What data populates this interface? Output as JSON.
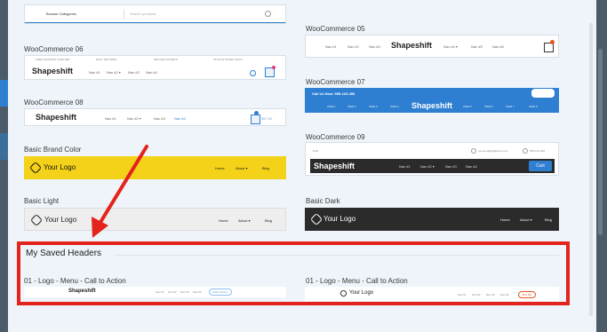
{
  "search_header": {
    "category_label": "Browse Categories",
    "placeholder": "Search products..."
  },
  "woo05": {
    "title": "WooCommerce 05",
    "logo": "Shapeshift",
    "nav": [
      "Nav #1",
      "Nav #2",
      "Nav #3",
      "Nav #4 ▾",
      "Nav #5",
      "Nav #6"
    ]
  },
  "woo06": {
    "title": "WooCommerce 06",
    "topbar": [
      "FREE SHIPPING OVER $60",
      "EASY RETURNS",
      "SECURE PAYMENT",
      "30 DAYS MONEY BACK"
    ],
    "logo": "Shapeshift",
    "nav": [
      "Nav #1",
      "Nav #2 ▾",
      "Nav #3",
      "Nav #4"
    ]
  },
  "woo07": {
    "title": "WooCommerce 07",
    "phone": "Call Us Now: 555-123-456",
    "logo": "Shapeshift",
    "items": [
      "ITEM 1",
      "ITEM 2",
      "ITEM 3",
      "ITEM 4",
      "ITEM 5",
      "ITEM 6",
      "ITEM 7",
      "ITEM 8"
    ]
  },
  "woo08": {
    "title": "WooCommerce 08",
    "logo": "Shapeshift",
    "nav": [
      "Nav #1",
      "Nav #2 ▾",
      "Nav #3",
      "Nav #4"
    ],
    "price": "$57.00"
  },
  "woo09": {
    "title": "WooCommerce 09",
    "email": "youremail@address.com",
    "phone": "555-123-456",
    "logo": "Shapeshift",
    "nav": [
      "Nav #1",
      "Nav #2 ▾",
      "Nav #3",
      "Nav #4"
    ],
    "cart_label": "Cart"
  },
  "brand": {
    "title": "Basic Brand Color",
    "logo": "Your Logo",
    "nav": [
      "Home",
      "About ▾",
      "Blog"
    ]
  },
  "light": {
    "title": "Basic Light",
    "logo": "Your Logo",
    "nav": [
      "Home",
      "About ▾",
      "Blog"
    ]
  },
  "dark": {
    "title": "Basic Dark",
    "logo": "Your Logo",
    "nav": [
      "Home",
      "About ▾",
      "Blog"
    ]
  },
  "saved": {
    "heading": "My Saved Headers",
    "items": [
      {
        "title": "01 - Logo - Menu - Call to Action",
        "logo": "Shapeshift",
        "nav": [
          "Nav #1",
          "Nav #2",
          "Nav #3",
          "Nav #4"
        ],
        "cta": "Call to Action"
      },
      {
        "title": "01 - Logo - Menu - Call to Action",
        "logo": "Your Logo",
        "nav": [
          "Nav #1",
          "Nav #2",
          "Nav #3",
          "Nav #4"
        ],
        "cta": "Buy Me"
      }
    ]
  },
  "colors": {
    "brand_yellow": "#f4d21a",
    "dark_bg": "#2b2b2b",
    "blue": "#2e7fd1",
    "annotation_red": "#e3231c"
  }
}
